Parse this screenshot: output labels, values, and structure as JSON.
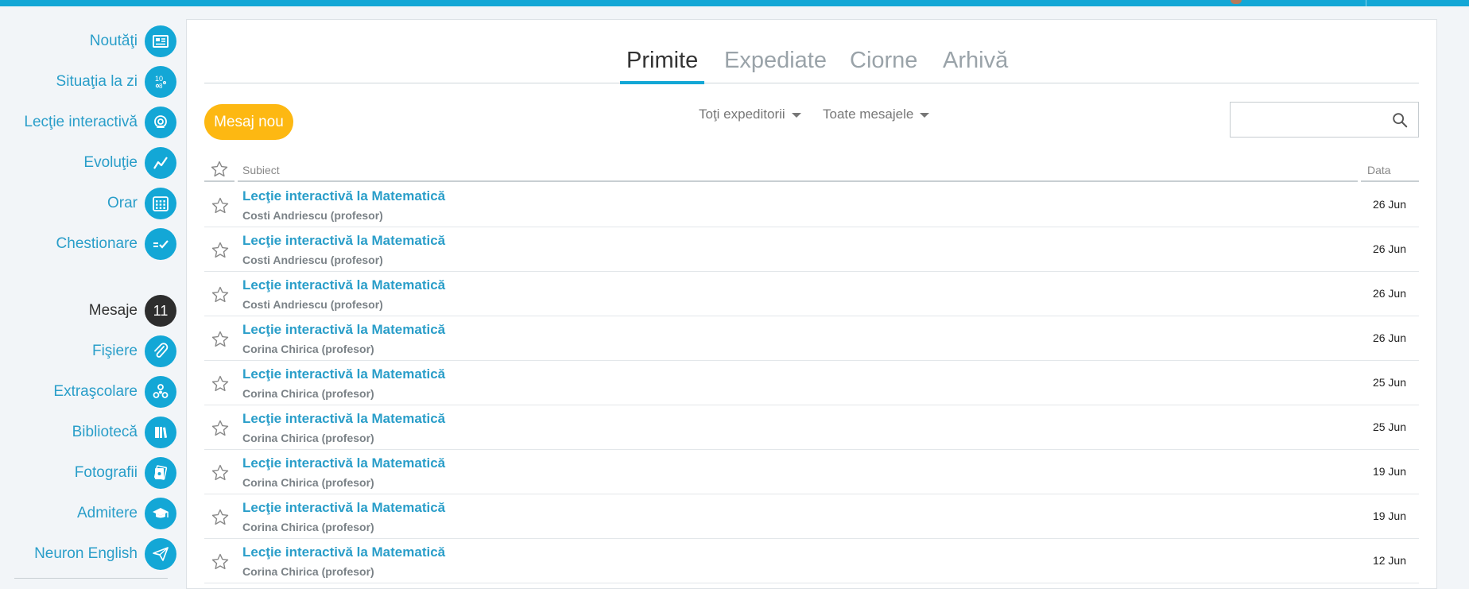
{
  "colors": {
    "accent": "#13a7d6",
    "new_message_button": "#fdb812",
    "badge": "#2d2d2d",
    "link": "#2a9ec9"
  },
  "sidebar": {
    "items": [
      {
        "label": "Noutăţi",
        "icon": "newspaper-icon"
      },
      {
        "label": "Situaţia la zi",
        "icon": "grades-icon"
      },
      {
        "label": "Lecţie interactivă",
        "icon": "webcam-icon"
      },
      {
        "label": "Evoluţie",
        "icon": "trend-chart-icon"
      },
      {
        "label": "Orar",
        "icon": "calendar-icon"
      },
      {
        "label": "Chestionare",
        "icon": "checklist-icon"
      },
      {
        "label": "Mesaje",
        "badge": "11"
      },
      {
        "label": "Fişiere",
        "icon": "paperclip-icon"
      },
      {
        "label": "Extraşcolare",
        "icon": "fidget-spinner-icon"
      },
      {
        "label": "Bibliotecă",
        "icon": "books-icon"
      },
      {
        "label": "Fotografii",
        "icon": "photos-icon"
      },
      {
        "label": "Admitere",
        "icon": "graduation-cap-icon"
      },
      {
        "label": "Neuron English",
        "icon": "paper-plane-icon"
      }
    ]
  },
  "tabs": [
    "Primite",
    "Expediate",
    "Ciorne",
    "Arhivă"
  ],
  "toolbar": {
    "new_message_label": "Mesaj nou",
    "filter_senders": "Toţi expeditorii",
    "filter_messages": "Toate mesajele",
    "search_placeholder": ""
  },
  "table": {
    "header_subject": "Subiect",
    "header_date": "Data",
    "rows": [
      {
        "subject": "Lecţie interactivă la Matematică",
        "sender": "Costi Andriescu (profesor)",
        "date": "26 Jun"
      },
      {
        "subject": "Lecţie interactivă la Matematică",
        "sender": "Costi Andriescu (profesor)",
        "date": "26 Jun"
      },
      {
        "subject": "Lecţie interactivă la Matematică",
        "sender": "Costi Andriescu (profesor)",
        "date": "26 Jun"
      },
      {
        "subject": "Lecţie interactivă la Matematică",
        "sender": "Corina Chirica (profesor)",
        "date": "26 Jun"
      },
      {
        "subject": "Lecţie interactivă la Matematică",
        "sender": "Corina Chirica (profesor)",
        "date": "25 Jun"
      },
      {
        "subject": "Lecţie interactivă la Matematică",
        "sender": "Corina Chirica (profesor)",
        "date": "25 Jun"
      },
      {
        "subject": "Lecţie interactivă la Matematică",
        "sender": "Corina Chirica (profesor)",
        "date": "19 Jun"
      },
      {
        "subject": "Lecţie interactivă la Matematică",
        "sender": "Corina Chirica (profesor)",
        "date": "19 Jun"
      },
      {
        "subject": "Lecţie interactivă la Matematică",
        "sender": "Corina Chirica (profesor)",
        "date": "12 Jun"
      }
    ]
  }
}
